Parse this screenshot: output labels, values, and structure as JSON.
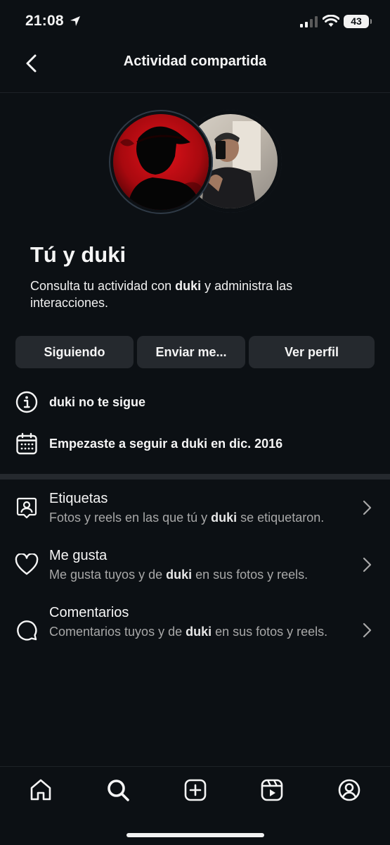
{
  "status": {
    "time": "21:08",
    "battery": "43"
  },
  "header": {
    "title": "Actividad compartida"
  },
  "title": "Tú y duki",
  "description": {
    "before": "Consulta tu actividad con ",
    "user": "duki",
    "after": " y administra las interacciones."
  },
  "buttons": {
    "follow": "Siguiendo",
    "message": "Enviar me...",
    "profile": "Ver perfil"
  },
  "info": {
    "not_following": "duki no te sigue",
    "since": "Empezaste a seguir a duki en dic. 2016"
  },
  "list": [
    {
      "label": "Etiquetas",
      "sub_before": "Fotos y reels en las que tú y ",
      "sub_user": "duki",
      "sub_after": " se etiquetaron."
    },
    {
      "label": "Me gusta",
      "sub_before": "Me gusta tuyos y de ",
      "sub_user": "duki",
      "sub_after": " en sus fotos y reels."
    },
    {
      "label": "Comentarios",
      "sub_before": "Comentarios tuyos y de ",
      "sub_user": "duki",
      "sub_after": " en sus fotos y reels."
    }
  ],
  "icons": {
    "back": "chevron-left-icon",
    "info": "info-icon",
    "calendar": "calendar-icon",
    "tag": "tag-person-icon",
    "like": "heart-icon",
    "comment": "comment-icon",
    "chevron": "chevron-right-icon",
    "tabs": [
      "home-icon",
      "search-icon",
      "create-icon",
      "reels-icon",
      "profile-icon"
    ]
  },
  "colors": {
    "background": "#0c1014",
    "button": "#25292e",
    "secondary_text": "#a8a8a8"
  }
}
